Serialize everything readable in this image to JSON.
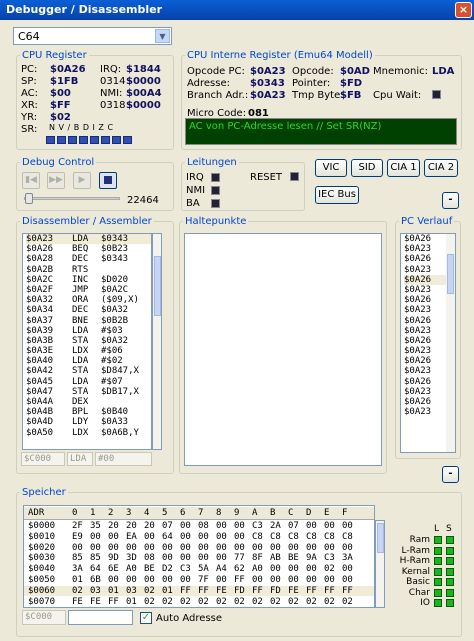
{
  "window": {
    "title": "Debugger / Disassembler",
    "close_glyph": "×"
  },
  "device_select": {
    "value": "C64",
    "arrow": "▼"
  },
  "cpu_register": {
    "title": "CPU Register",
    "rows": [
      {
        "l1": "PC:",
        "v1": "$0A26",
        "l2": "IRQ:",
        "v2": "$1844"
      },
      {
        "l1": "SP:",
        "v1": "$1FB",
        "l2": "0314",
        "v2": "$0000"
      },
      {
        "l1": "AC:",
        "v1": "$00",
        "l2": "NMI:",
        "v2": "$00A4"
      },
      {
        "l1": "XR:",
        "v1": "$FF",
        "l2": "0318",
        "v2": "$0000"
      },
      {
        "l1": "YR:",
        "v1": "$02",
        "l2": "",
        "v2": ""
      }
    ],
    "sr_label": "SR:",
    "flags": "N V / B D I Z C"
  },
  "cpu_intern": {
    "title": "CPU Interne Register (Emu64 Modell)",
    "rows": [
      {
        "l1": "Opcode PC:",
        "v1": "$0A23",
        "l2": "Opcode:",
        "v2": "$0AD",
        "l3": "Mnemonic:",
        "v3": "LDA"
      },
      {
        "l1": "Adresse:",
        "v1": "$0343",
        "l2": "Pointer:",
        "v2": "$FD",
        "l3": "",
        "v3": ""
      },
      {
        "l1": "Branch Adr.:",
        "v1": "$0A23",
        "l2": "Tmp Byte:",
        "v2": "$FB",
        "l3": "Cpu Wait:",
        "v3": ""
      }
    ],
    "micro_label": "Micro Code:",
    "micro_value": "081",
    "micro_text": "AC von PC-Adresse lesen // Set SR(NZ)"
  },
  "debug_control": {
    "title": "Debug Control",
    "cycles": "22464"
  },
  "leitungen": {
    "title": "Leitungen",
    "lines": [
      "IRQ",
      "NMI",
      "BA"
    ],
    "reset": "RESET"
  },
  "chip_buttons": [
    "VIC",
    "SID",
    "CIA 1",
    "CIA 2"
  ],
  "iec_button": "IEC Bus",
  "minus_label": "-",
  "disassembler": {
    "title": "Disassembler / Assembler",
    "rows": [
      {
        "addr": "$0A23",
        "op": "LDA",
        "arg": "$0343"
      },
      {
        "addr": "$0A26",
        "op": "BEQ",
        "arg": "$0B23"
      },
      {
        "addr": "$0A28",
        "op": "DEC",
        "arg": "$0343"
      },
      {
        "addr": "$0A2B",
        "op": "RTS",
        "arg": ""
      },
      {
        "addr": "$0A2C",
        "op": "INC",
        "arg": "$D020"
      },
      {
        "addr": "$0A2F",
        "op": "JMP",
        "arg": "$0A2C"
      },
      {
        "addr": "$0A32",
        "op": "ORA",
        "arg": "($09,X)"
      },
      {
        "addr": "$0A34",
        "op": "DEC",
        "arg": "$0A32"
      },
      {
        "addr": "$0A37",
        "op": "BNE",
        "arg": "$0B2B"
      },
      {
        "addr": "$0A39",
        "op": "LDA",
        "arg": "#$03"
      },
      {
        "addr": "$0A3B",
        "op": "STA",
        "arg": "$0A32"
      },
      {
        "addr": "$0A3E",
        "op": "LDX",
        "arg": "#$06"
      },
      {
        "addr": "$0A40",
        "op": "LDA",
        "arg": "#$02"
      },
      {
        "addr": "$0A42",
        "op": "STA",
        "arg": "$D847,X"
      },
      {
        "addr": "$0A45",
        "op": "LDA",
        "arg": "#$07"
      },
      {
        "addr": "$0A47",
        "op": "STA",
        "arg": "$DB17,X"
      },
      {
        "addr": "$0A4A",
        "op": "DEX",
        "arg": ""
      },
      {
        "addr": "$0A4B",
        "op": "BPL",
        "arg": "$0B40"
      },
      {
        "addr": "$0A4D",
        "op": "LDY",
        "arg": "$0A33"
      },
      {
        "addr": "$0A50",
        "op": "LDX",
        "arg": "$0A6B,Y"
      }
    ],
    "input_addr": "$C000",
    "input_op": "LDA",
    "input_arg": "#00"
  },
  "haltepunkte": {
    "title": "Haltepunkte"
  },
  "pc_verlauf": {
    "title": "PC Verlauf",
    "rows": [
      "$0A26",
      "$0A23",
      "$0A26",
      "$0A23",
      "$0A26",
      "$0A23",
      "$0A26",
      "$0A23",
      "$0A26",
      "$0A23",
      "$0A26",
      "$0A23",
      "$0A26",
      "$0A23",
      "$0A26",
      "$0A23",
      "$0A26",
      "$0A23"
    ]
  },
  "speicher": {
    "title": "Speicher",
    "header": [
      "ADR",
      "0",
      "1",
      "2",
      "3",
      "4",
      "5",
      "6",
      "7",
      "8",
      "9",
      "A",
      "B",
      "C",
      "D",
      "E",
      "F"
    ],
    "rows": [
      [
        "$0000",
        "2F",
        "35",
        "20",
        "20",
        "20",
        "07",
        "00",
        "08",
        "00",
        "00",
        "C3",
        "2A",
        "07",
        "00",
        "00",
        "00"
      ],
      [
        "$0010",
        "E9",
        "00",
        "00",
        "EA",
        "00",
        "64",
        "00",
        "00",
        "00",
        "00",
        "C8",
        "C8",
        "C8",
        "C8",
        "C8",
        "C8"
      ],
      [
        "$0020",
        "00",
        "00",
        "00",
        "00",
        "00",
        "00",
        "00",
        "00",
        "00",
        "00",
        "00",
        "00",
        "00",
        "00",
        "00",
        "00"
      ],
      [
        "$0030",
        "85",
        "85",
        "9D",
        "3D",
        "08",
        "00",
        "00",
        "00",
        "00",
        "77",
        "8F",
        "AB",
        "BE",
        "9A",
        "C3",
        "3A"
      ],
      [
        "$0040",
        "3A",
        "64",
        "6E",
        "A0",
        "BE",
        "D2",
        "C3",
        "5A",
        "A4",
        "62",
        "A0",
        "00",
        "00",
        "00",
        "02",
        "00"
      ],
      [
        "$0050",
        "01",
        "6B",
        "00",
        "00",
        "00",
        "00",
        "00",
        "7F",
        "00",
        "FF",
        "00",
        "00",
        "00",
        "00",
        "00",
        "00"
      ],
      [
        "$0060",
        "02",
        "03",
        "01",
        "03",
        "02",
        "01",
        "FF",
        "FF",
        "FE",
        "FD",
        "FF",
        "FD",
        "FE",
        "FF",
        "FF",
        "FF"
      ],
      [
        "$0070",
        "FE",
        "FE",
        "FF",
        "01",
        "02",
        "02",
        "02",
        "02",
        "02",
        "02",
        "02",
        "02",
        "02",
        "02",
        "02",
        "02"
      ]
    ],
    "input_addr": "$C000",
    "auto_label": "Auto Adresse",
    "check": "✓",
    "ls_header": [
      "L",
      "S"
    ],
    "legend": [
      "Ram",
      "L-Ram",
      "H-Ram",
      "Kernal",
      "Basic",
      "Char",
      "IO"
    ]
  }
}
